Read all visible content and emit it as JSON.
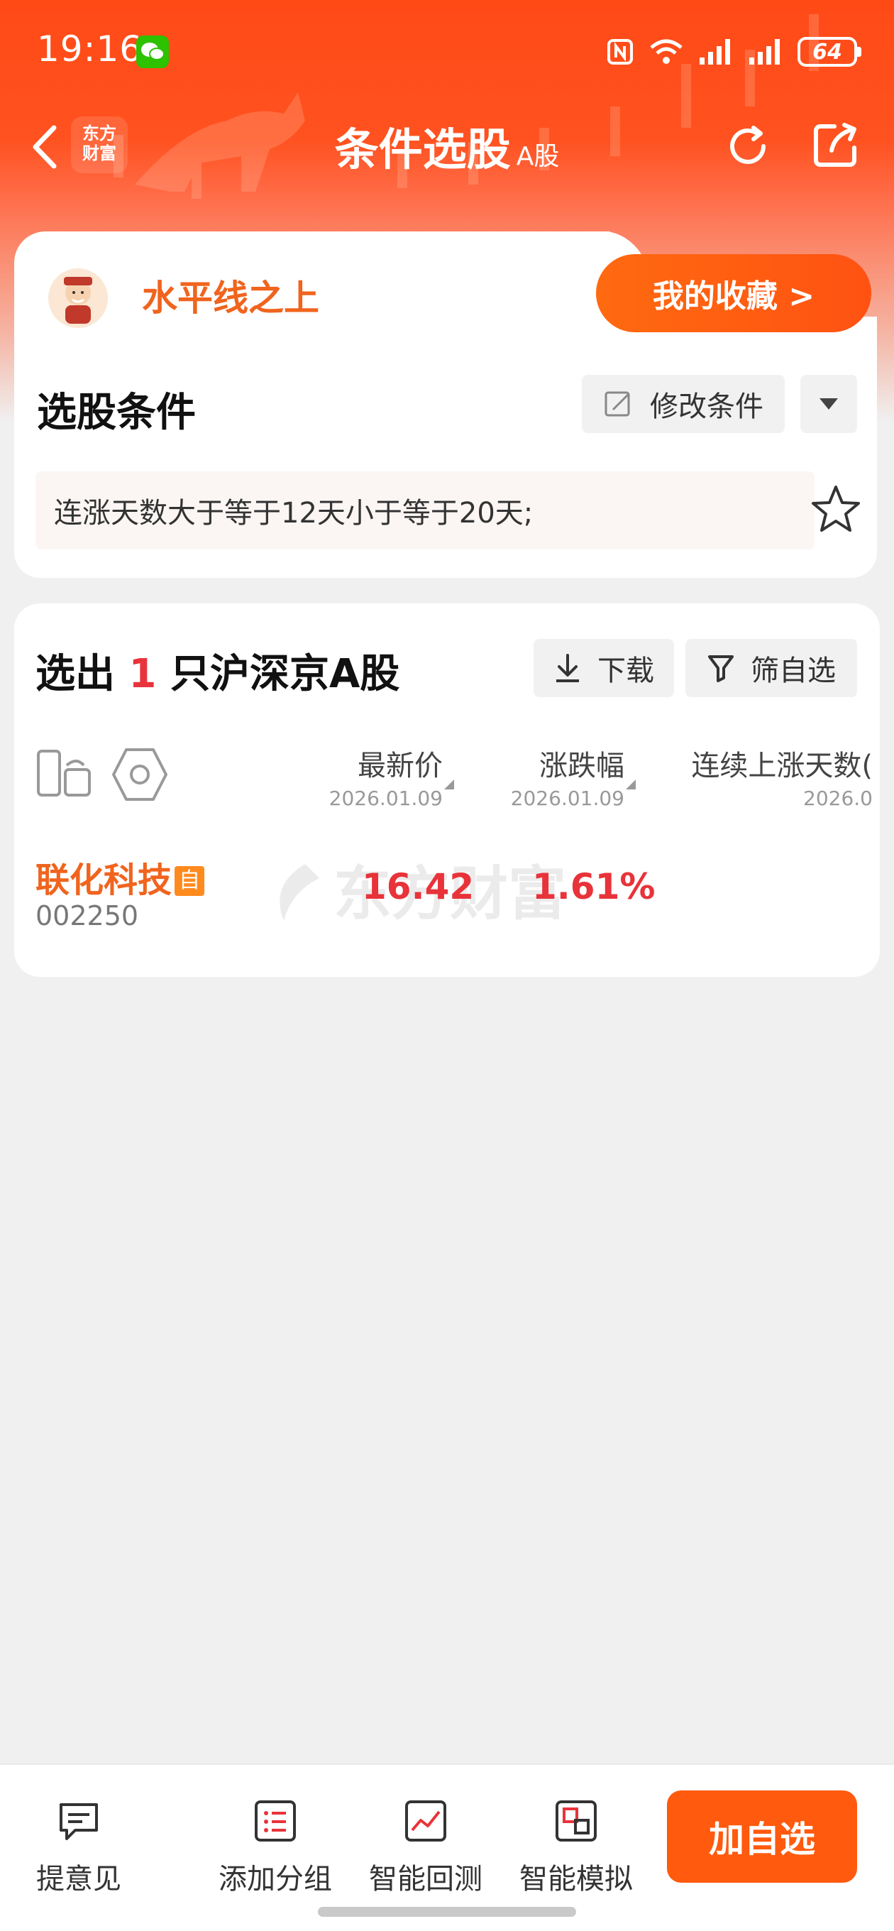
{
  "status_bar": {
    "time": "19:16",
    "battery": "64"
  },
  "nav": {
    "logo_line1": "东方",
    "logo_line2": "财富",
    "title": "条件选股",
    "title_sub": "A股"
  },
  "strategy": {
    "name": "水平线之上",
    "favorites_label": "我的收藏 >"
  },
  "conditions": {
    "section_title": "选股条件",
    "edit_label": "修改条件",
    "text": "连涨天数大于等于12天小于等于20天;"
  },
  "results": {
    "title_prefix": "选出",
    "count": "1",
    "title_suffix": "只沪深京A股",
    "download_label": "下载",
    "filter_label": "筛自选",
    "columns": [
      {
        "name": "最新价",
        "date": "2026.01.09"
      },
      {
        "name": "涨跌幅",
        "date": "2026.01.09"
      },
      {
        "name": "连续上涨天数(",
        "date": "2026.0"
      }
    ],
    "rows": [
      {
        "name": "联化科技",
        "badge": "自",
        "code": "002250",
        "price": "16.42",
        "change": "1.61%"
      }
    ],
    "watermark": "东方财富"
  },
  "bottom_bar": {
    "feedback": "提意见",
    "add_group": "添加分组",
    "backtest": "智能回测",
    "simulate": "智能模拟",
    "add_watchlist": "加自选"
  },
  "colors": {
    "brand_orange": "#ff5a0e",
    "header_red": "#ff4a16",
    "up_red": "#e8333a",
    "strategy_orange": "#f0641e"
  }
}
